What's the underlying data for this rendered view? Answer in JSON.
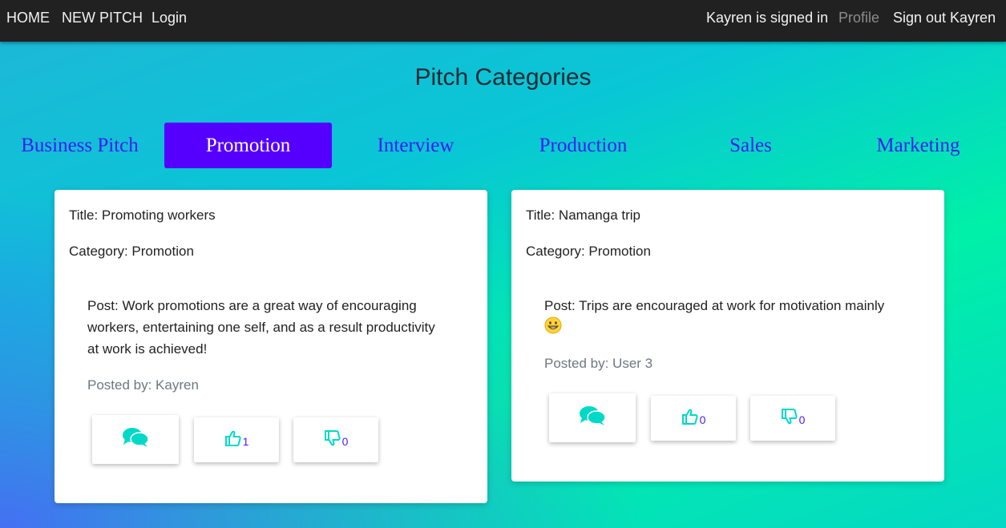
{
  "nav": {
    "home": "HOME",
    "new_pitch": "NEW PITCH",
    "login": "Login",
    "signed_in": "Kayren is signed in",
    "profile": "Profile",
    "sign_out": "Sign out Kayren"
  },
  "page_title": "Pitch Categories",
  "categories": [
    {
      "label": "Business Pitch",
      "active": false
    },
    {
      "label": "Promotion",
      "active": true
    },
    {
      "label": "Interview",
      "active": false
    },
    {
      "label": "Production",
      "active": false
    },
    {
      "label": "Sales",
      "active": false
    },
    {
      "label": "Marketing",
      "active": false
    }
  ],
  "pitches": [
    {
      "title": "Title: Promoting workers",
      "category": "Category: Promotion",
      "post_lines": [
        "Post: Work promotions are a great way of encouraging",
        "workers, entertaining one self, and as a result productivity",
        "at work is achieved!"
      ],
      "posted_by": "Posted by: Kayren",
      "likes": "1",
      "dislikes": "0"
    },
    {
      "title": "Title: Namanga trip",
      "category": "Category: Promotion",
      "post_lines": [
        "Post: Trips are encouraged at work for motivation mainly"
      ],
      "emoji": "grinning-face-emoji",
      "posted_by": "Posted by: User 3",
      "likes": "0",
      "dislikes": "0"
    }
  ],
  "icons": {
    "comment": "comments-icon",
    "like": "thumbs-up-icon",
    "dislike": "thumbs-down-icon"
  },
  "colors": {
    "navbar": "#212121",
    "accent": "#5500ff",
    "category_text": "#3d1df2",
    "icon": "#00d9c8"
  }
}
